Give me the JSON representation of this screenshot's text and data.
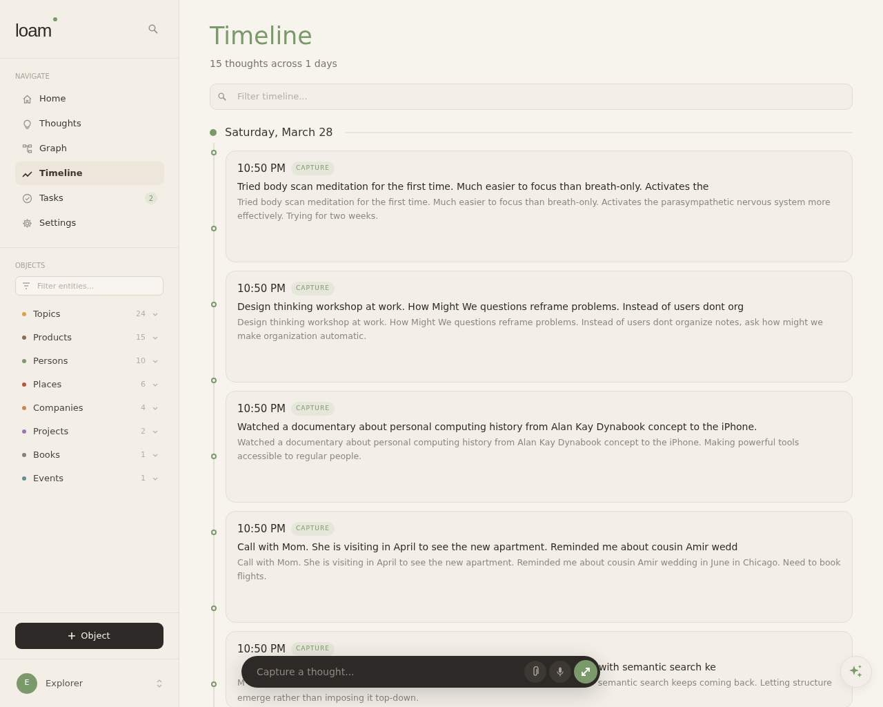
{
  "brand": {
    "name": "loam"
  },
  "nav_heading": "NAVIGATE",
  "nav": [
    {
      "label": "Home",
      "selected": false
    },
    {
      "label": "Thoughts",
      "selected": false
    },
    {
      "label": "Graph",
      "selected": false
    },
    {
      "label": "Timeline",
      "selected": true
    },
    {
      "label": "Tasks",
      "selected": false,
      "badge": "2"
    },
    {
      "label": "Settings",
      "selected": false
    }
  ],
  "objects_heading": "OBJECTS",
  "entity_filter": {
    "placeholder": "Filter entities..."
  },
  "objects": [
    {
      "label": "Topics",
      "count": "24",
      "color": "#d9a24a"
    },
    {
      "label": "Products",
      "count": "15",
      "color": "#8a6e52"
    },
    {
      "label": "Persons",
      "count": "10",
      "color": "#7a9a6a"
    },
    {
      "label": "Places",
      "count": "6",
      "color": "#b8573a"
    },
    {
      "label": "Companies",
      "count": "4",
      "color": "#c88a55"
    },
    {
      "label": "Projects",
      "count": "2",
      "color": "#9a78b0"
    },
    {
      "label": "Books",
      "count": "1",
      "color": "#858078"
    },
    {
      "label": "Events",
      "count": "1",
      "color": "#5f8f8c"
    }
  ],
  "new_object_button": "Object",
  "user": {
    "initial": "E",
    "name": "Explorer"
  },
  "page": {
    "title": "Timeline",
    "subtitle": "15 thoughts across 1 days"
  },
  "timeline_filter": {
    "placeholder": "Filter timeline..."
  },
  "day": {
    "label": "Saturday, March 28"
  },
  "entries": [
    {
      "time": "10:50 PM",
      "tag": "CAPTURE",
      "title": "Tried body scan meditation for the first time. Much easier to focus than breath-only. Activates the",
      "body": "Tried body scan meditation for the first time. Much easier to focus than breath-only. Activates the parasympathetic nervous system more effectively. Trying for two weeks."
    },
    {
      "time": "10:50 PM",
      "tag": "CAPTURE",
      "title": "Design thinking workshop at work. How Might We questions reframe problems. Instead of users dont org",
      "body": "Design thinking workshop at work. How Might We questions reframe problems. Instead of users dont organize notes, ask how might we make organization automatic."
    },
    {
      "time": "10:50 PM",
      "tag": "CAPTURE",
      "title": "Watched a documentary about personal computing history from Alan Kay Dynabook concept to the iPhone.",
      "body": "Watched a documentary about personal computing history from Alan Kay Dynabook concept to the iPhone. Making powerful tools accessible to regular people."
    },
    {
      "time": "10:50 PM",
      "tag": "CAPTURE",
      "title": "Call with Mom. She is visiting in April to see the new apartment. Reminded me about cousin Amir wedd",
      "body": "Call with Mom. She is visiting in April to see the new apartment. Reminded me about cousin Amir wedding in June in Chicago. Need to book flights."
    }
  ],
  "covered_entry": {
    "time": "10:50 PM",
    "tag": "CAPTURE",
    "title_end": "with semantic search ke",
    "body_start": "M",
    "body_end": "semantic search keeps coming back. Letting structure",
    "body_line2": "emerge rather than imposing it top-down."
  },
  "capture_bar": {
    "placeholder": "Capture a thought..."
  }
}
